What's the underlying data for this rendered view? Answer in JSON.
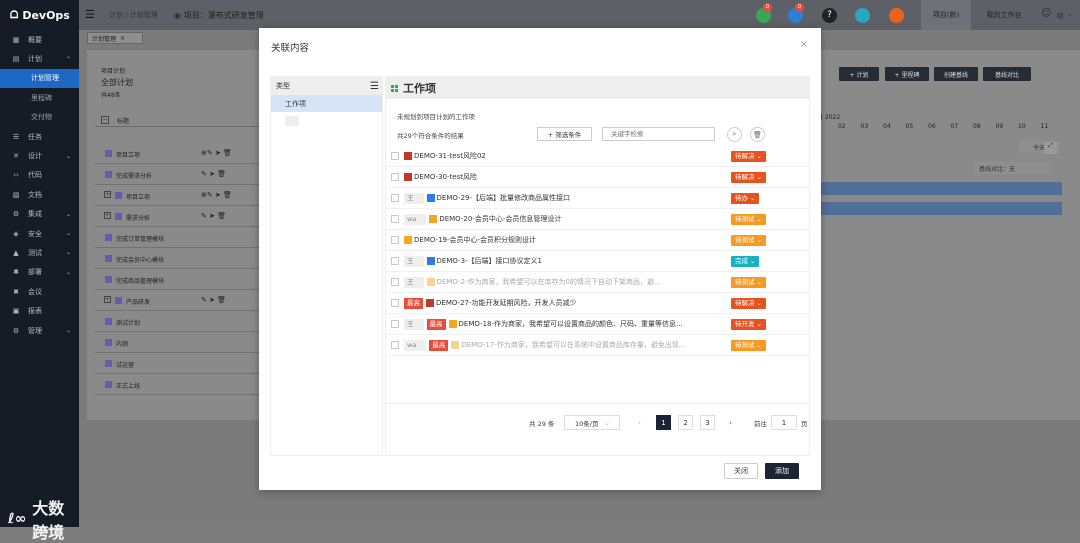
{
  "app": {
    "logo_text": "DevOps"
  },
  "sidebar": {
    "items": [
      {
        "icon": "dashboard-icon",
        "glyph": "▦",
        "label": "概要"
      },
      {
        "icon": "calendar-icon",
        "glyph": "▤",
        "label": "计划",
        "expanded": true
      },
      {
        "label": "计划管理",
        "sub": true,
        "active": true
      },
      {
        "label": "里程碑",
        "sub": true
      },
      {
        "label": "交付物",
        "sub": true
      },
      {
        "icon": "task-icon",
        "glyph": "☰",
        "label": "任务"
      },
      {
        "icon": "design-icon",
        "glyph": "✕",
        "label": "设计",
        "chevron": true
      },
      {
        "icon": "code-icon",
        "glyph": "‹›",
        "label": "代码"
      },
      {
        "icon": "doc-icon",
        "glyph": "▧",
        "label": "文档"
      },
      {
        "icon": "integration-icon",
        "glyph": "⚙",
        "label": "集成",
        "chevron": true
      },
      {
        "icon": "security-icon",
        "glyph": "◈",
        "label": "安全",
        "chevron": true
      },
      {
        "icon": "test-icon",
        "glyph": "▲",
        "label": "测试",
        "chevron": true
      },
      {
        "icon": "deploy-icon",
        "glyph": "✱",
        "label": "部署",
        "chevron": true
      },
      {
        "icon": "meeting-icon",
        "glyph": "✖",
        "label": "会议"
      },
      {
        "icon": "report-icon",
        "glyph": "▣",
        "label": "报表"
      },
      {
        "icon": "manage-icon",
        "glyph": "⚙",
        "label": "管理",
        "chevron": true
      }
    ]
  },
  "watermark": "大数跨境",
  "header": {
    "breadcrumb": "计划 / 计划管理",
    "project": "项目：瀑布式研发管理",
    "tab_project": "项目(新)",
    "tab_mywork": "我的工作台",
    "user": "赵",
    "badges": [
      "0",
      "0"
    ]
  },
  "bg": {
    "tab": "计划管理",
    "card_label": "项目计划",
    "card_title": "全部计划",
    "card_count": "共48条",
    "col_title": "标题",
    "buttons": [
      "+ 计划",
      "+ 里程碑",
      "创建基线",
      "基线对比"
    ],
    "timeline_year": "月 2022",
    "timeline_cols": [
      "02",
      "03",
      "04",
      "05",
      "06",
      "07",
      "08",
      "09",
      "10",
      "11"
    ],
    "today_btn": "今天",
    "baseline_select": "基线对比：无",
    "rows": [
      "项目立项",
      "完成需求分析",
      "项目立项",
      "需求分析",
      "完成订单管理模块",
      "完成会员中心模块",
      "完成商品管理模块",
      "产品研发",
      "测试计划",
      "内测",
      "试运营",
      "正式上线"
    ]
  },
  "modal": {
    "title": "关联内容",
    "type_header": "类型",
    "type_item": "工作项",
    "content_title": "工作项",
    "subtitle": "未规划到项目计划的工作项",
    "count_text": "共29个符合条件的结果",
    "filter_btn": "+ 筛选条件",
    "search_placeholder": "关键字检索",
    "items": [
      {
        "owner": "",
        "prio": "",
        "type": "risk",
        "text": "DEMO-31-test风险02",
        "status": "待解决",
        "status_color": "#e8521e",
        "dim": false
      },
      {
        "owner": "",
        "prio": "",
        "type": "risk",
        "text": "DEMO-30-test风险",
        "status": "待解决",
        "status_color": "#e8521e",
        "dim": false
      },
      {
        "owner": "王",
        "prio": "",
        "type": "task",
        "text": "DEMO-29-【后端】批量修改商品属性接口",
        "status": "待办",
        "status_color": "#e8521e",
        "dim": false
      },
      {
        "owner": "wa",
        "prio": "",
        "type": "story",
        "text": "DEMO-20-会员中心-会员信息管理设计",
        "status": "待测试",
        "status_color": "#f59a23",
        "dim": false
      },
      {
        "owner": "",
        "prio": "",
        "type": "story",
        "text": "DEMO-19-会员中心-会员积分规则设计",
        "status": "待测试",
        "status_color": "#f59a23",
        "dim": false
      },
      {
        "owner": "王",
        "prio": "",
        "type": "task",
        "text": "DEMO-3-【后端】接口协议定义1",
        "status": "完成",
        "status_color": "#1ab0c4",
        "dim": false
      },
      {
        "owner": "王",
        "prio": "",
        "type": "story",
        "text": "DEMO-2-作为商家，我希望可以在库存为0的情况下自动下架商品，避...",
        "status": "待测试",
        "status_color": "#f59a23",
        "dim": true
      },
      {
        "owner": "",
        "prio": "最高",
        "type": "risk",
        "text": "DEMO-27-功能开发延期风险，开发人员减少",
        "status": "待解决",
        "status_color": "#e8521e",
        "dim": false
      },
      {
        "owner": "王",
        "prio": "最高",
        "type": "story",
        "text": "DEMO-18-作为商家，我希望可以设置商品的颜色、尺码、重量等信息...",
        "status": "待开发",
        "status_color": "#e8521e",
        "dim": false
      },
      {
        "owner": "wa",
        "prio": "最高",
        "type": "story",
        "text": "DEMO-17-作为商家，我希望可以在系统中设置商品库存量，避免出现...",
        "status": "待测试",
        "status_color": "#f59a23",
        "dim": true
      }
    ],
    "pagination": {
      "total": "共 29 条",
      "page_size": "10条/页",
      "pages": [
        "1",
        "2",
        "3"
      ],
      "current": "1",
      "goto_label": "前往",
      "goto_value": "1",
      "page_suffix": "页"
    },
    "close_btn": "关闭",
    "add_btn": "添加"
  },
  "colors": {
    "accent": "#1d68c6",
    "primary_dark": "#1c2433",
    "sidebar_bg": "#161c26"
  }
}
